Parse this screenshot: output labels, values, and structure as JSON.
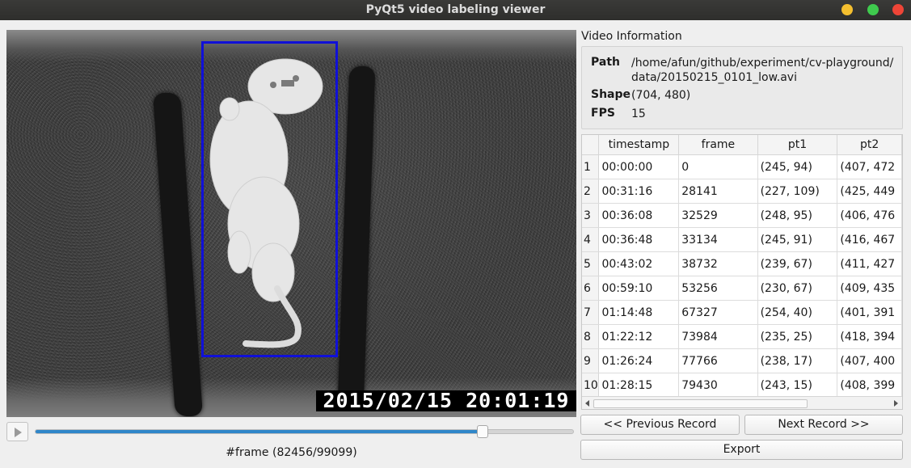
{
  "window": {
    "title": "PyQt5 video labeling viewer"
  },
  "video": {
    "overlay_timestamp": "2015/02/15 20:01:19",
    "bbox_color": "#1010d8"
  },
  "player": {
    "frame_label": "#frame (82456/99099)",
    "current_frame": 82456,
    "total_frames": 99099,
    "slider_fraction": 0.832,
    "slider_color": "#2f86c9"
  },
  "info": {
    "group_title": "Video Information",
    "path_key": "Path",
    "path_value": "/home/afun/github/experiment/cv-playground/ data/20150215_0101_low.avi",
    "shape_key": "Shape",
    "shape_value": "(704, 480)",
    "fps_key": "FPS",
    "fps_value": "15"
  },
  "table": {
    "columns": [
      "timestamp",
      "frame",
      "pt1",
      "pt2"
    ],
    "rows": [
      {
        "n": "1",
        "timestamp": "00:00:00",
        "frame": "0",
        "pt1": "(245, 94)",
        "pt2": "(407, 472"
      },
      {
        "n": "2",
        "timestamp": "00:31:16",
        "frame": "28141",
        "pt1": "(227, 109)",
        "pt2": "(425, 449"
      },
      {
        "n": "3",
        "timestamp": "00:36:08",
        "frame": "32529",
        "pt1": "(248, 95)",
        "pt2": "(406, 476"
      },
      {
        "n": "4",
        "timestamp": "00:36:48",
        "frame": "33134",
        "pt1": "(245, 91)",
        "pt2": "(416, 467"
      },
      {
        "n": "5",
        "timestamp": "00:43:02",
        "frame": "38732",
        "pt1": "(239, 67)",
        "pt2": "(411, 427"
      },
      {
        "n": "6",
        "timestamp": "00:59:10",
        "frame": "53256",
        "pt1": "(230, 67)",
        "pt2": "(409, 435"
      },
      {
        "n": "7",
        "timestamp": "01:14:48",
        "frame": "67327",
        "pt1": "(254, 40)",
        "pt2": "(401, 391"
      },
      {
        "n": "8",
        "timestamp": "01:22:12",
        "frame": "73984",
        "pt1": "(235, 25)",
        "pt2": "(418, 394"
      },
      {
        "n": "9",
        "timestamp": "01:26:24",
        "frame": "77766",
        "pt1": "(238, 17)",
        "pt2": "(407, 400"
      },
      {
        "n": "10",
        "timestamp": "01:28:15",
        "frame": "79430",
        "pt1": "(243, 15)",
        "pt2": "(408, 399"
      }
    ]
  },
  "buttons": {
    "prev_label": "<< Previous Record",
    "next_label": "Next Record >>",
    "export_label": "Export"
  }
}
